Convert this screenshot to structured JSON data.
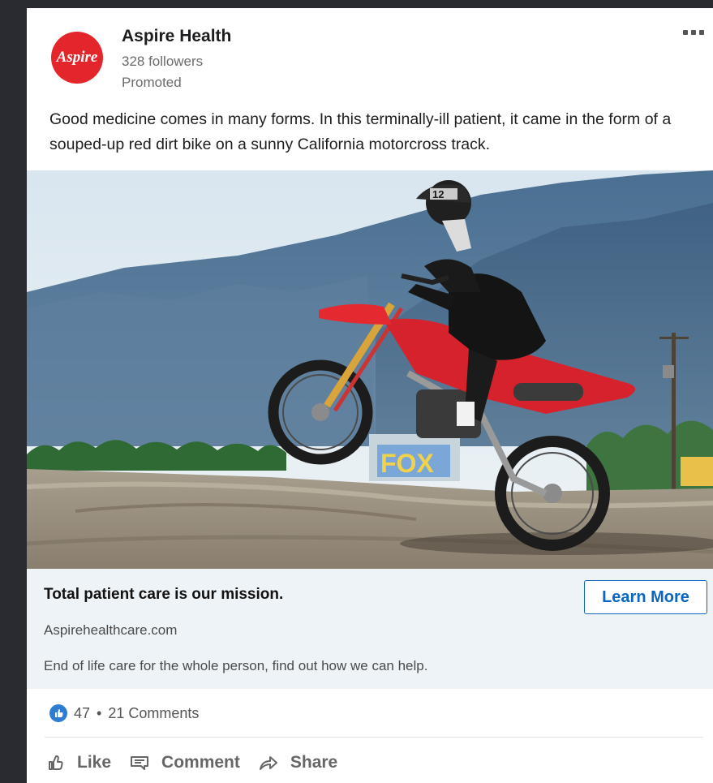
{
  "post": {
    "company_name": "Aspire Health",
    "followers": "328 followers",
    "promoted": "Promoted",
    "logo_text": "Aspire",
    "more_icon": "more-horizontal-icon",
    "body": "Good medicine comes in many forms. In this terminally-ill patient, it came in the form of a souped-up red dirt bike on a sunny California motorcross track."
  },
  "cta": {
    "title": "Total patient care is our mission.",
    "url": "Aspirehealthcare.com",
    "description": "End of life care for the whole person, find out how we can help.",
    "button_label": "Learn More",
    "accent": "#0a66c2"
  },
  "social": {
    "reactions": "47",
    "separator": "•",
    "comments": "21 Comments"
  },
  "actions": {
    "like": "Like",
    "comment": "Comment",
    "share": "Share"
  },
  "image": {
    "bike_number": "12",
    "wall_text": "FOX"
  },
  "colors": {
    "brand_red": "#e3262b",
    "like_blue": "#2f7cd3",
    "page_bg": "#2a2b30"
  }
}
